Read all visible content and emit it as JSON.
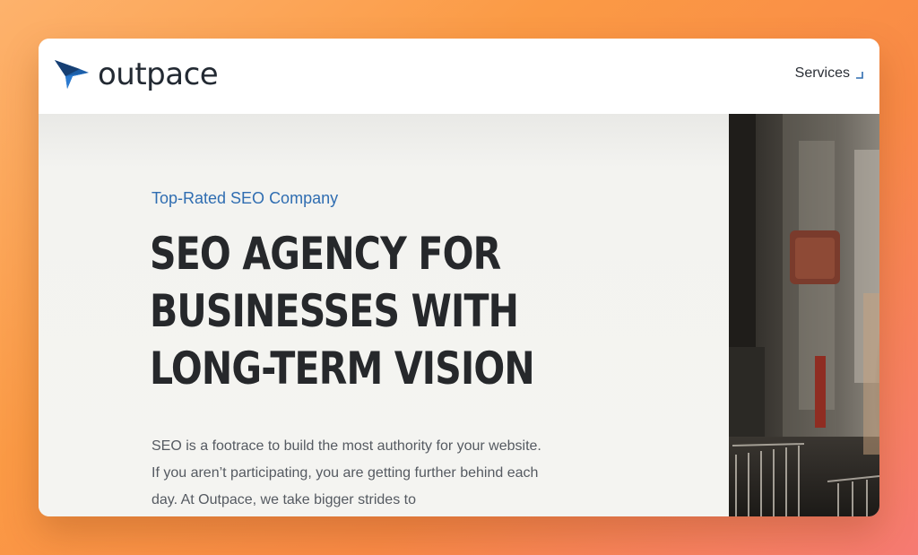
{
  "header": {
    "logo_text": "outpace",
    "nav_services": "Services"
  },
  "hero": {
    "eyebrow": "Top-Rated SEO Company",
    "headline": "SEO AGENCY FOR BUSINESSES WITH LONG-TERM VISION",
    "body": "SEO is a footrace to build the most authority for your website. If you aren’t participating, you are getting further behind each day. At Outpace, we take bigger strides to"
  },
  "colors": {
    "accent_blue": "#2f6db1",
    "headline": "#26282b",
    "background_gradient_start": "#fdb26c",
    "background_gradient_end": "#f67a72"
  },
  "icons": {
    "logo": "outpace-arrow-logo-icon",
    "services_dropdown": "corner-arrow-icon"
  }
}
